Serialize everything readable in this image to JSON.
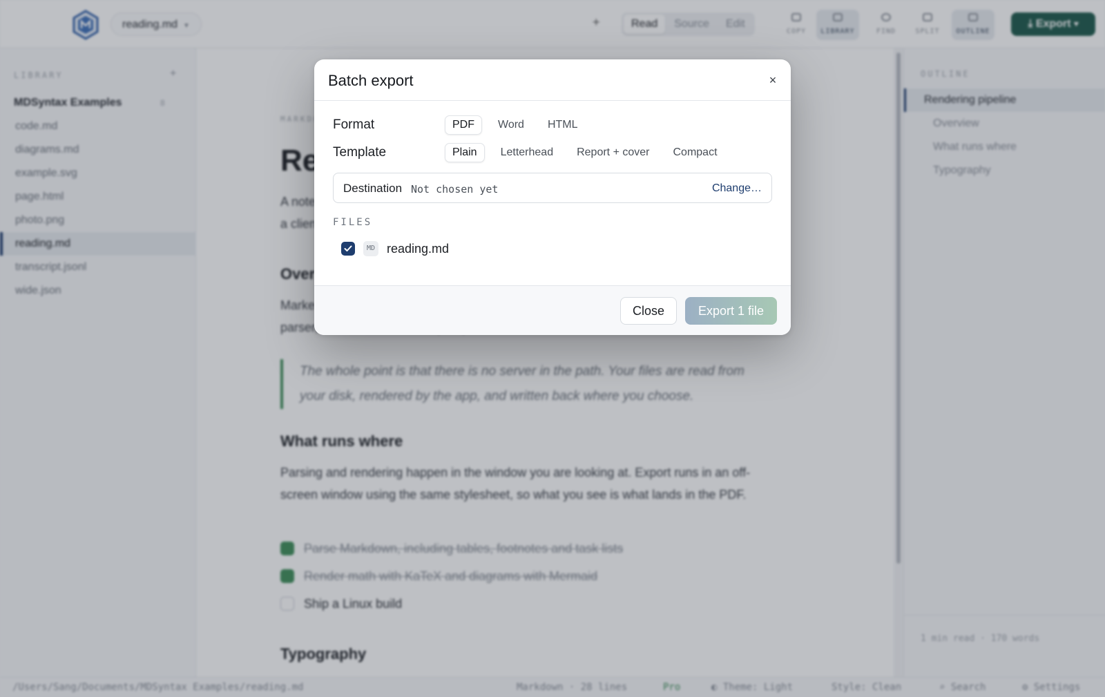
{
  "topbar": {
    "file_name": "reading.md",
    "modes": [
      "Read",
      "Source",
      "Edit"
    ],
    "active_mode": "Read",
    "tools": [
      "COPY",
      "LIBRARY",
      "FIND",
      "SPLIT",
      "OUTLINE"
    ],
    "export_label": "Export",
    "colors": {
      "accent": "#1e3d6e",
      "brand_green": "#1e5a4c"
    }
  },
  "sidebar": {
    "heading": "LIBRARY",
    "group": "MDSyntax Examples",
    "group_count": "8",
    "items": [
      "code.md",
      "diagrams.md",
      "example.svg",
      "page.html",
      "photo.png",
      "reading.md",
      "transcript.jsonl",
      "wide.json"
    ],
    "active_item": "reading.md"
  },
  "doc": {
    "eyebrow": "MARKDOWN",
    "title": "Re",
    "intro_lines": [
      "A note",
      "a clien"
    ],
    "h_overview": "Over",
    "overview_lines": [
      "Marke",
      "parser, a renderer and an export path, and none of them talk to a server."
    ],
    "quote": "The whole point is that there is no server in the path. Your files are read from your disk, rendered by the app, and written back where you choose.",
    "h_runs": "What runs where",
    "runs_text": "Parsing and rendering happen in the window you are looking at. Export runs in an off-screen window using the same stylesheet, so what you see is what lands in the PDF.",
    "tasks": [
      {
        "text": "Parse Markdown, including tables, footnotes and task lists",
        "done": true
      },
      {
        "text": "Render math with KaTeX and diagrams with Mermaid",
        "done": true
      },
      {
        "text": "Ship a Linux build",
        "done": false
      }
    ],
    "h_typography": "Typography"
  },
  "outline": {
    "heading": "OUTLINE",
    "items": [
      "Rendering pipeline",
      "Overview",
      "What runs where",
      "Typography"
    ],
    "footer": "1 min read · 170 words"
  },
  "statusbar": {
    "path": "/Users/Sang/Documents/MDSyntax Examples/reading.md",
    "lang_lines": "Markdown · 28 lines",
    "plan": "Pro",
    "theme": "◐ Theme: Light",
    "style": "Style: Clean",
    "search": "⌕ Search",
    "settings": "⚙ Settings"
  },
  "modal": {
    "title": "Batch export",
    "close_glyph": "×",
    "format_label": "Format",
    "formats": [
      "PDF",
      "Word",
      "HTML"
    ],
    "selected_format": "PDF",
    "template_label": "Template",
    "templates": [
      "Plain",
      "Letterhead",
      "Report + cover",
      "Compact"
    ],
    "selected_template": "Plain",
    "destination_label": "Destination",
    "destination_value": "Not chosen yet",
    "change_label": "Change…",
    "files_heading": "FILES",
    "files": [
      {
        "name": "reading.md",
        "badge": "MD",
        "checked": true
      }
    ],
    "close_button": "Close",
    "export_button": "Export 1 file"
  }
}
